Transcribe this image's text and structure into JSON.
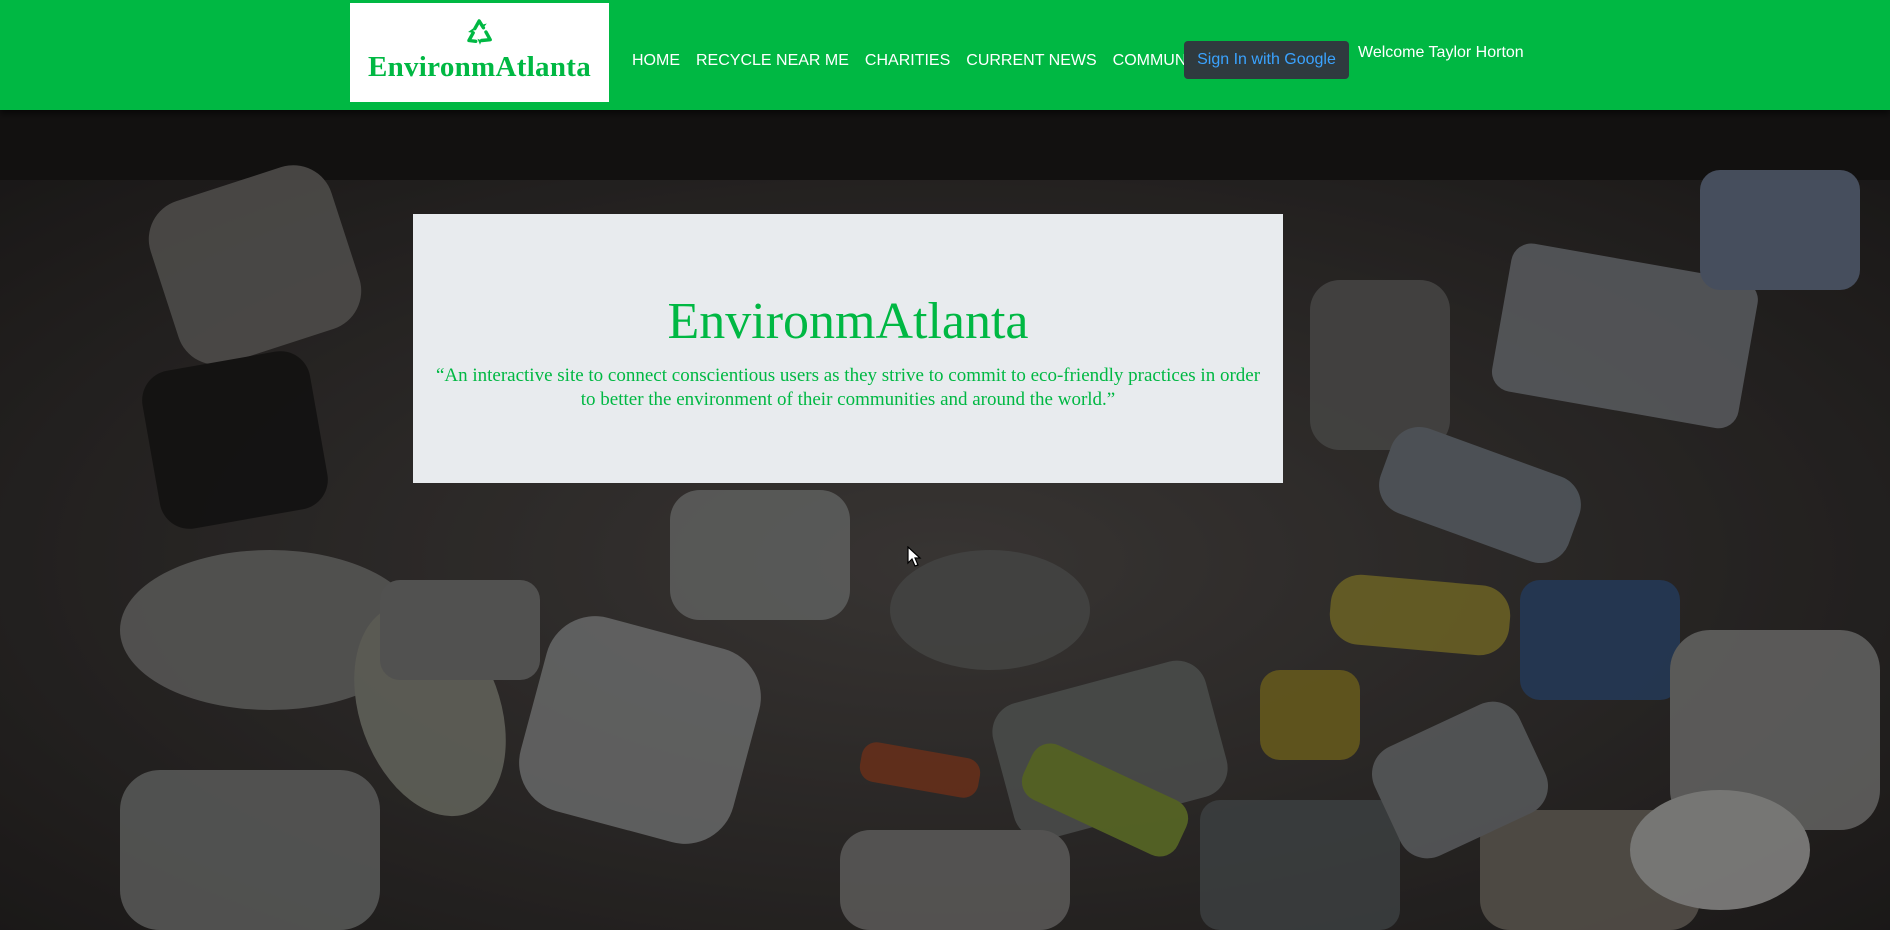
{
  "header": {
    "logo_text": "EnvironmAtlanta",
    "logo_icon": "recycle-icon",
    "nav": [
      {
        "label": "HOME"
      },
      {
        "label": "RECYCLE NEAR ME"
      },
      {
        "label": "CHARITIES"
      },
      {
        "label": "CURRENT NEWS"
      },
      {
        "label": "COMMUNITY"
      }
    ],
    "signin_label": "Sign In with Google",
    "welcome_text": "Welcome Taylor Horton"
  },
  "hero": {
    "title": "EnvironmAtlanta",
    "quote": "“An interactive site to connect conscientious users as they strive to commit to eco-friendly practices in order to better the environment of their communities and around the world.”"
  },
  "colors": {
    "brand_green": "#00b843",
    "card_bg": "#e8ebee",
    "button_bg": "#2f3a3f",
    "button_text": "#3aa3ff"
  }
}
